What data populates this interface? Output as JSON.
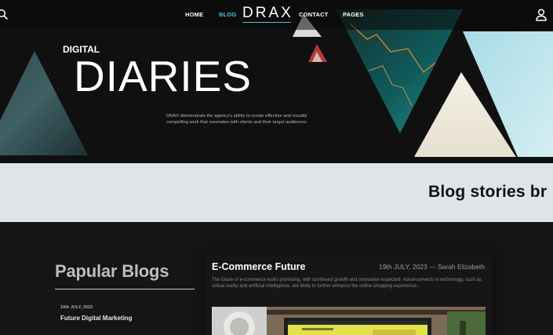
{
  "nav": {
    "links": [
      "HOME",
      "BLOG",
      "CONTACT",
      "PAGES"
    ],
    "active": "BLOG",
    "logo": "DRAX",
    "accent_color": "#49c7d7",
    "icons": [
      "search-icon",
      "user-icon"
    ]
  },
  "hero": {
    "kicker": "DIGITAL",
    "title": "DIARIES",
    "description": "DRAX demonstrate the agency's ability to create effective and visually compelling work that resonates with clients and their target audiences."
  },
  "band": {
    "title": "Blog stories br"
  },
  "popular": {
    "title": "Papular Blogs",
    "items": [
      {
        "date": "19th JULY, 2023",
        "name": "Future Digital Marketing"
      }
    ]
  },
  "featured": {
    "title": "E-Commerce Future",
    "meta": "19th JULY, 2023 — Sarah Elizabeth",
    "text": "The future of e-commerce looks promising, with continued growth and innovation expected. Advancements in technology, such as virtual reality and artificial intelligence, are likely to further enhance the online shopping experience..."
  }
}
